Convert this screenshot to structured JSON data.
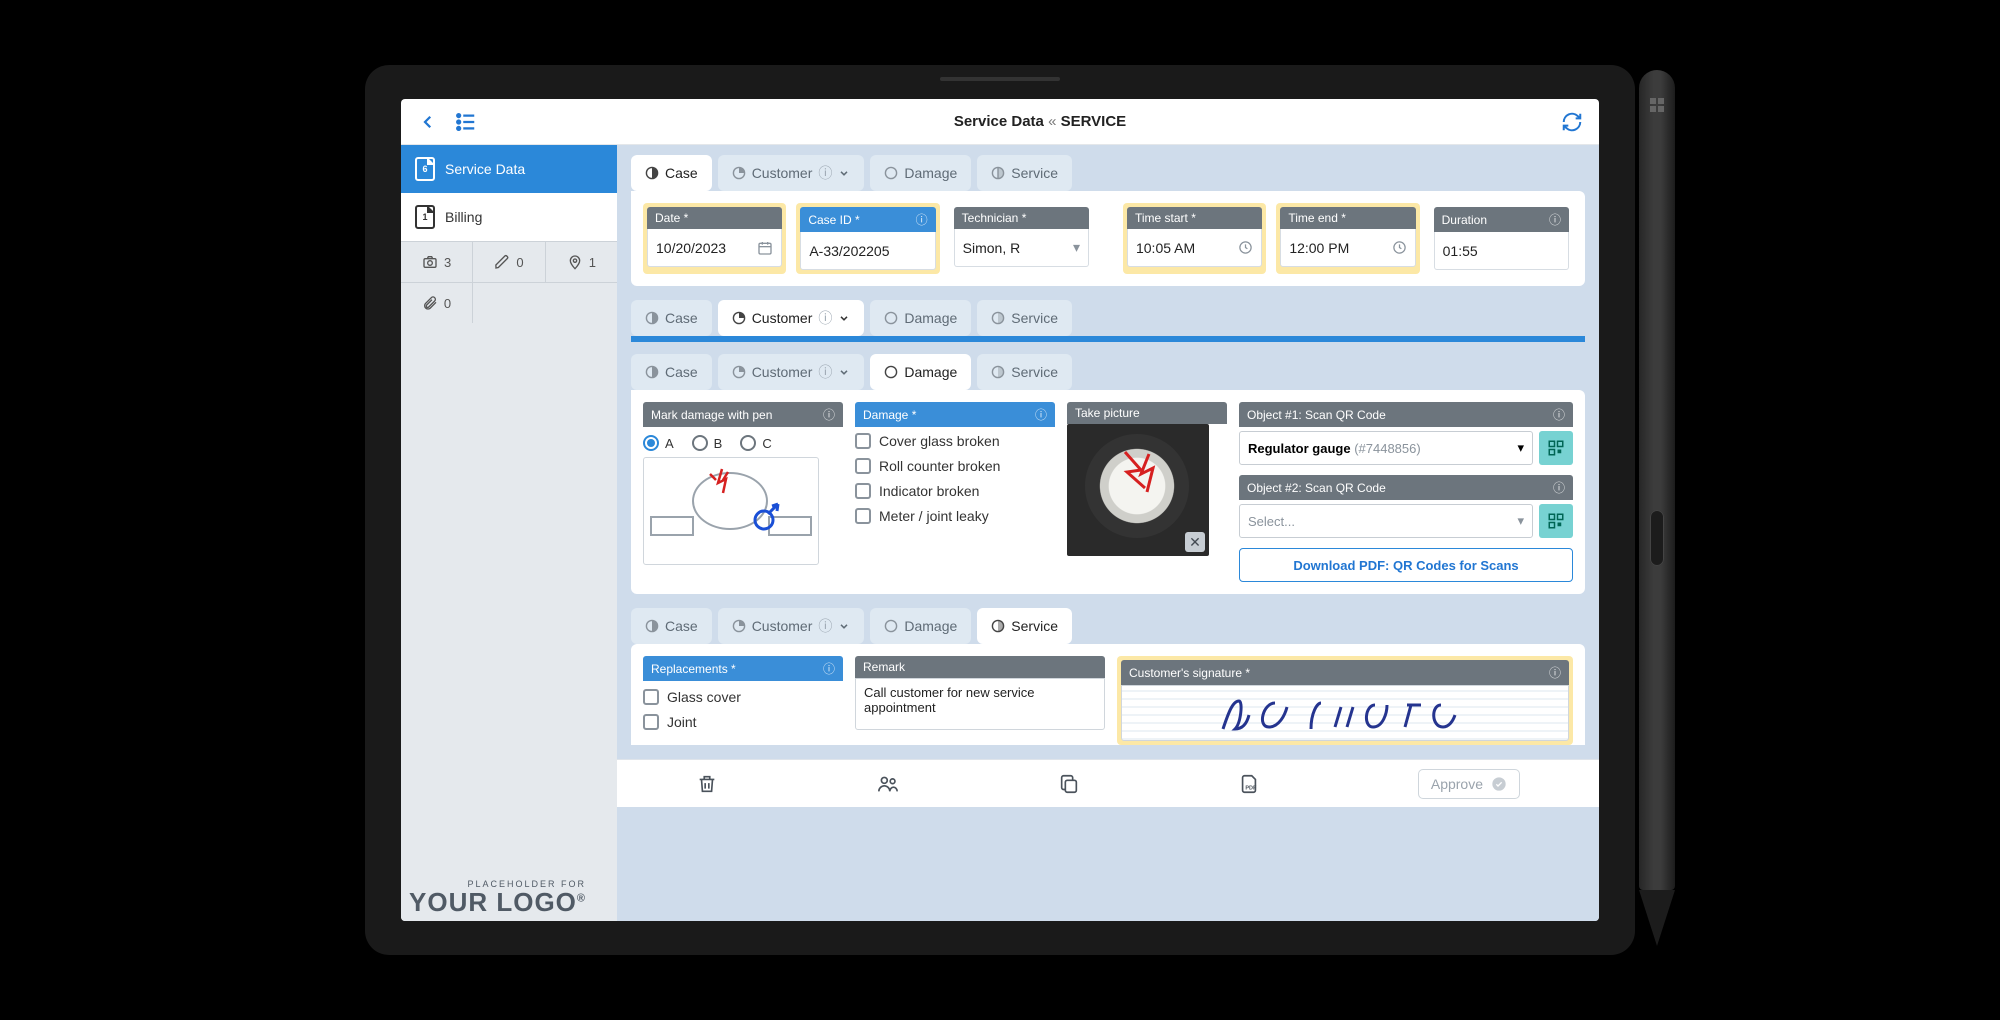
{
  "header": {
    "title_left": "Service Data",
    "sep": "«",
    "title_right": "SERVICE"
  },
  "sidebar": {
    "items": [
      {
        "label": "Service Data",
        "badge": "6"
      },
      {
        "label": "Billing",
        "badge": "1"
      }
    ],
    "counts": {
      "photos": "3",
      "edits": "0",
      "pins": "1",
      "attachments": "0"
    }
  },
  "tabs": {
    "case": "Case",
    "customer": "Customer",
    "damage": "Damage",
    "service": "Service"
  },
  "case": {
    "date_label": "Date *",
    "date_value": "10/20/2023",
    "caseid_label": "Case ID *",
    "caseid_value": "A-33/202205",
    "tech_label": "Technician *",
    "tech_value": "Simon, R",
    "tstart_label": "Time start *",
    "tstart_value": "10:05 AM",
    "tend_label": "Time end *",
    "tend_value": "12:00 PM",
    "dur_label": "Duration",
    "dur_value": "01:55"
  },
  "damage": {
    "mark_label": "Mark damage with pen",
    "opt_a": "A",
    "opt_b": "B",
    "opt_c": "C",
    "dmg_label": "Damage *",
    "checks": [
      "Cover glass broken",
      "Roll counter broken",
      "Indicator broken",
      "Meter / joint leaky"
    ],
    "pic_label": "Take picture",
    "scan1_label": "Object #1: Scan QR Code",
    "scan1_value": "Regulator gauge",
    "scan1_id": "(#7448856)",
    "scan2_label": "Object #2: Scan QR Code",
    "scan2_placeholder": "Select...",
    "download": "Download PDF: QR Codes for Scans"
  },
  "service": {
    "repl_label": "Replacements *",
    "repl_checks": [
      "Glass cover",
      "Joint"
    ],
    "remark_label": "Remark",
    "remark_value": "Call customer for new service appointment",
    "sig_label": "Customer's signature *"
  },
  "bottom": {
    "approve": "Approve"
  },
  "logo": {
    "small": "PLACEHOLDER FOR",
    "big": "YOUR LOGO"
  }
}
